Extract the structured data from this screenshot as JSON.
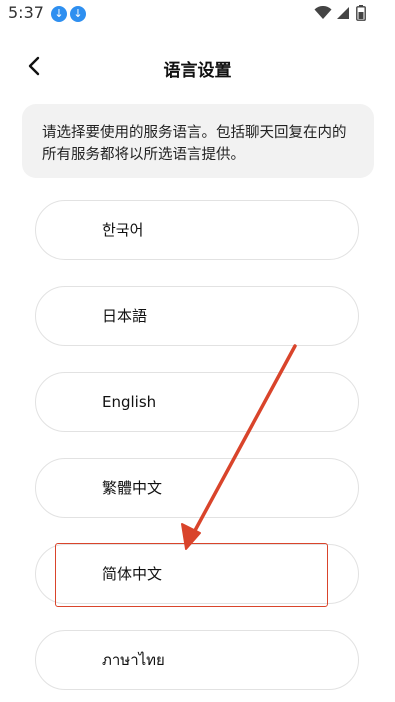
{
  "status_bar": {
    "time": "5:37",
    "icons": [
      "download-icon",
      "download-icon",
      "wifi-icon",
      "cell-signal-icon",
      "battery-icon"
    ],
    "download_icon_color": "#2e8ff0"
  },
  "header": {
    "back_icon": "chevron-left-icon",
    "title": "语言设置"
  },
  "notice": {
    "text": "请选择要使用的服务语言。包括聊天回复在内的所有服务都将以所选语言提供。"
  },
  "languages": [
    {
      "label": "한국어"
    },
    {
      "label": "日本語"
    },
    {
      "label": "English"
    },
    {
      "label": "繁體中文"
    },
    {
      "label": "简体中文"
    },
    {
      "label": "ภาษาไทย"
    }
  ],
  "annotation": {
    "color": "#d9442b",
    "highlighted_option": "简体中文"
  }
}
